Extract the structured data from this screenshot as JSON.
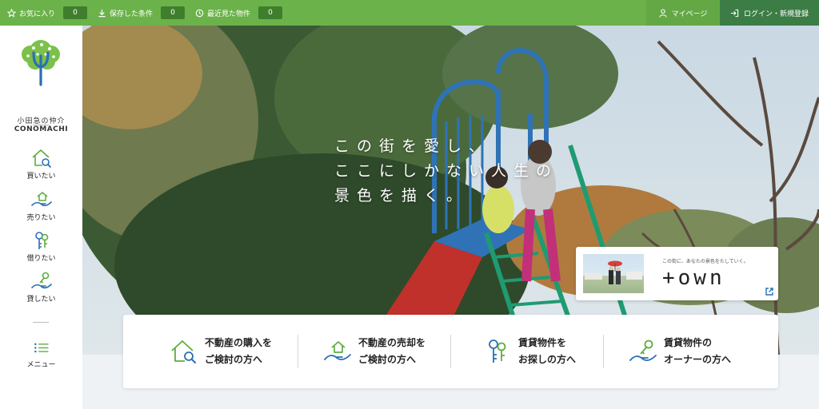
{
  "topbar": {
    "favorites": {
      "label": "お気に入り",
      "count": "0",
      "icon": "star-icon"
    },
    "saved": {
      "label": "保存した条件",
      "count": "0",
      "icon": "download-icon"
    },
    "recent": {
      "label": "最近見た物件",
      "count": "0",
      "icon": "clock-icon"
    },
    "mypage": {
      "label": "マイページ",
      "icon": "person-icon"
    },
    "login": {
      "label": "ログイン・新規登録",
      "icon": "login-icon"
    }
  },
  "sidebar": {
    "brand_jp": "小田急の仲介",
    "brand_en": "CONOMACHI",
    "items": [
      {
        "label": "買いたい",
        "icon": "house-search-icon"
      },
      {
        "label": "売りたい",
        "icon": "house-hand-icon"
      },
      {
        "label": "借りたい",
        "icon": "keys-icon"
      },
      {
        "label": "貸したい",
        "icon": "key-hand-icon"
      }
    ],
    "menu": {
      "label": "メニュー",
      "icon": "menu-list-icon"
    }
  },
  "hero": {
    "tagline": [
      "この街を愛し、",
      "ここにしかない人生の",
      "景色を描く。"
    ]
  },
  "town": {
    "subtitle": "この街に、あなたの景色をたしていく。",
    "logo_text": "+own",
    "icon": "external-link-icon"
  },
  "cards": [
    {
      "line1": "不動産の購入を",
      "line2": "ご検討の方へ",
      "icon": "house-search-icon"
    },
    {
      "line1": "不動産の売却を",
      "line2": "ご検討の方へ",
      "icon": "house-hand-icon"
    },
    {
      "line1": "賃貸物件を",
      "line2": "お探しの方へ",
      "icon": "keys-icon"
    },
    {
      "line1": "賃貸物件の",
      "line2": "オーナーの方へ",
      "icon": "key-hand-icon"
    }
  ],
  "colors": {
    "brand_green": "#6bb24a",
    "dark_green": "#3b7d45",
    "icon_green": "#5cae3c",
    "icon_blue": "#2a6fb5"
  }
}
